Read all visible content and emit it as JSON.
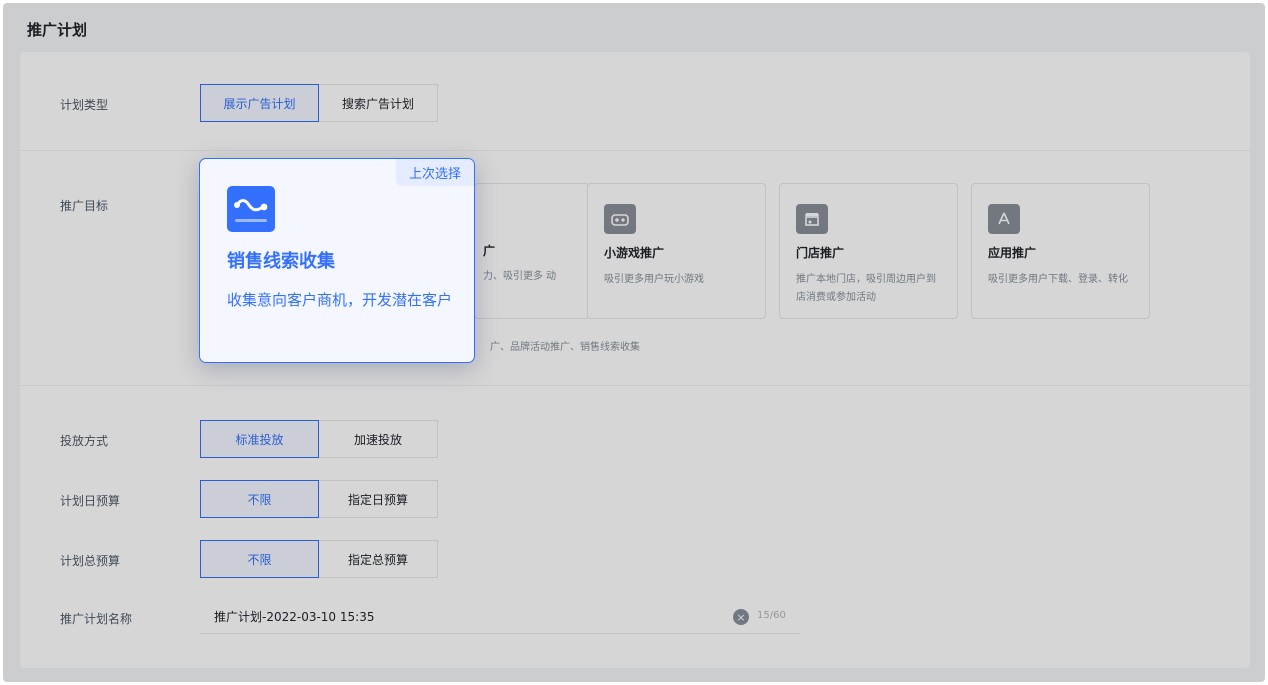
{
  "page_title": "推广计划",
  "plan_type": {
    "label": "计划类型",
    "options": [
      "展示广告计划",
      "搜索广告计划"
    ],
    "selected": "展示广告计划"
  },
  "goal": {
    "label": "推广目标",
    "partial_card": {
      "title": "广",
      "desc": "力、吸引更多 动"
    },
    "cards": [
      {
        "title": "小游戏推广",
        "desc": "吸引更多用户玩小游戏",
        "icon": "gamepad-icon"
      },
      {
        "title": "门店推广",
        "desc": "推广本地门店，吸引周边用户到店消费或参加活动",
        "icon": "store-icon"
      },
      {
        "title": "应用推广",
        "desc": "吸引更多用户下载、登录、转化",
        "icon": "app-store-icon"
      }
    ],
    "hint": "广、品牌活动推广、销售线索收集"
  },
  "delivery_mode": {
    "label": "投放方式",
    "options": [
      "标准投放",
      "加速投放"
    ],
    "selected": "标准投放"
  },
  "daily_budget": {
    "label": "计划日预算",
    "options": [
      "不限",
      "指定日预算"
    ],
    "selected": "不限"
  },
  "total_budget": {
    "label": "计划总预算",
    "options": [
      "不限",
      "指定总预算"
    ],
    "selected": "不限"
  },
  "plan_name": {
    "label": "推广计划名称",
    "value": "推广计划-2022-03-10 15:35",
    "counter": "15/60"
  },
  "popover": {
    "tag": "上次选择",
    "title": "销售线索收集",
    "desc": "收集意向客户商机，开发潜在客户",
    "icon": "lead-collection-icon",
    "accent": "#3370ff"
  }
}
